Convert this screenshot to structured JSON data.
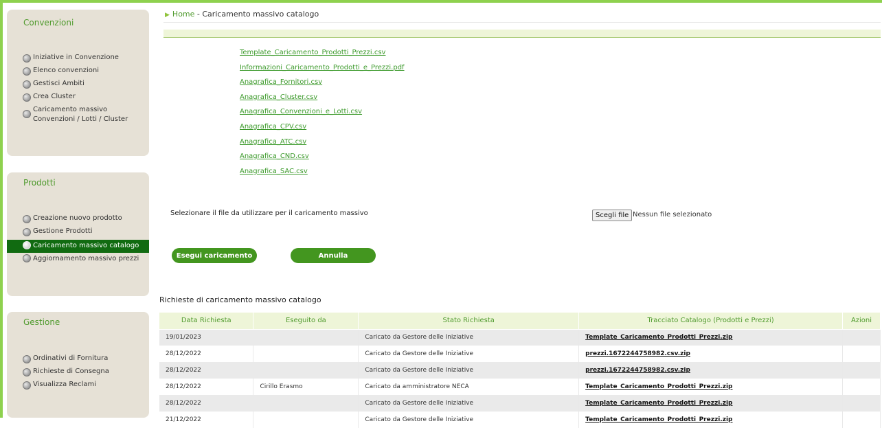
{
  "breadcrumb": {
    "home": "Home",
    "separator": " - ",
    "current": "Caricamento massivo catalogo"
  },
  "sidebar": {
    "convenzioni": {
      "title": "Convenzioni",
      "items": [
        {
          "label": "Iniziative in Convenzione"
        },
        {
          "label": "Elenco convenzioni"
        },
        {
          "label": "Gestisci Ambiti"
        },
        {
          "label": "Crea Cluster"
        },
        {
          "label": "Caricamento massivo Convenzioni / Lotti / Cluster"
        }
      ]
    },
    "prodotti": {
      "title": "Prodotti",
      "items": [
        {
          "label": "Creazione nuovo prodotto"
        },
        {
          "label": "Gestione Prodotti"
        },
        {
          "label": "Caricamento massivo catalogo",
          "active": true
        },
        {
          "label": "Aggiornamento massivo prezzi"
        }
      ]
    },
    "gestione": {
      "title": "Gestione",
      "items": [
        {
          "label": "Ordinativi di Fornitura"
        },
        {
          "label": "Richieste di Consegna"
        },
        {
          "label": "Visualizza Reclami"
        }
      ]
    }
  },
  "files": [
    "Template_Caricamento_Prodotti_Prezzi.csv",
    "Informazioni_Caricamento_Prodotti_e_Prezzi.pdf",
    "Anagrafica_Fornitori.csv",
    "Anagrafica_Cluster.csv",
    "Anagrafica_Convenzioni_e_Lotti.csv",
    "Anagrafica_CPV.csv",
    "Anagrafica_ATC.csv",
    "Anagrafica_CND.csv",
    "Anagrafica_SAC.csv"
  ],
  "upload": {
    "label": "Selezionare il file da utilizzare per il caricamento massivo",
    "button": "Scegli file",
    "status": "Nessun file selezionato"
  },
  "actions": {
    "run": "Esegui caricamento",
    "cancel": "Annulla"
  },
  "requests": {
    "title": "Richieste di caricamento massivo catalogo",
    "columns": [
      "Data Richiesta",
      "Eseguito da",
      "Stato Richiesta",
      "Tracciato Catalogo (Prodotti e Prezzi)",
      "Azioni"
    ],
    "rows": [
      {
        "date": "19/01/2023",
        "by": "",
        "status": "Caricato da Gestore delle Iniziative",
        "file": "Template_Caricamento_Prodotti_Prezzi.zip"
      },
      {
        "date": "28/12/2022",
        "by": "",
        "status": "Caricato da Gestore delle Iniziative",
        "file": "prezzi.1672244758982.csv.zip"
      },
      {
        "date": "28/12/2022",
        "by": "",
        "status": "Caricato da Gestore delle Iniziative",
        "file": "prezzi.1672244758982.csv.zip"
      },
      {
        "date": "28/12/2022",
        "by": "Cirillo Erasmo",
        "status": "Caricato da amministratore NECA",
        "file": "Template_Caricamento_Prodotti_Prezzi.zip"
      },
      {
        "date": "28/12/2022",
        "by": "",
        "status": "Caricato da Gestore delle Iniziative",
        "file": "Template_Caricamento_Prodotti_Prezzi.zip"
      },
      {
        "date": "21/12/2022",
        "by": "",
        "status": "Caricato da Gestore delle Iniziative",
        "file": "Template_Caricamento_Prodotti_Prezzi.zip"
      }
    ]
  },
  "colors": {
    "accent_green": "#43961f",
    "frame_green": "#8ed14e",
    "active_menu": "#116b11",
    "link_green": "#3c9a2b"
  }
}
